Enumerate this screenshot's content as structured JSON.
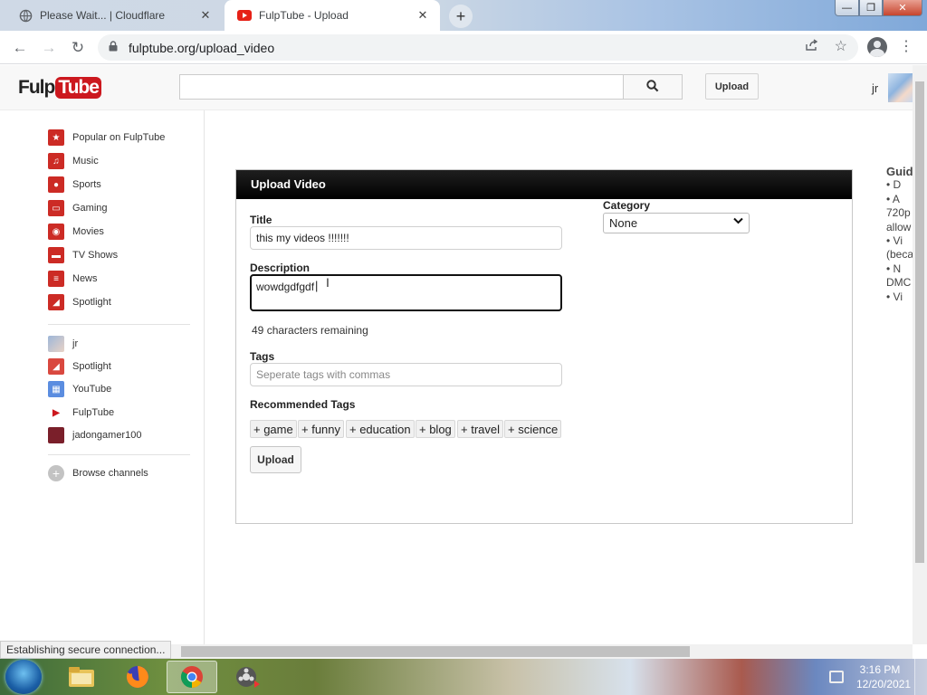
{
  "browser": {
    "tabs": [
      {
        "title": "Please Wait... | Cloudflare",
        "icon": "globe-icon"
      },
      {
        "title": "FulpTube - Upload",
        "icon": "fulptube-favicon-icon"
      }
    ],
    "url": "fulptube.org/upload_video"
  },
  "site": {
    "logo_left": "Fulp",
    "logo_right": "Tube",
    "upload_label": "Upload",
    "username": "jr"
  },
  "sidebar": {
    "top_items": [
      {
        "label": "Popular on FulpTube",
        "icon": "popular-icon"
      },
      {
        "label": "Music",
        "icon": "headphones-icon"
      },
      {
        "label": "Sports",
        "icon": "sports-icon"
      },
      {
        "label": "Gaming",
        "icon": "gamepad-icon"
      },
      {
        "label": "Movies",
        "icon": "film-icon"
      },
      {
        "label": "TV Shows",
        "icon": "tv-icon"
      },
      {
        "label": "News",
        "icon": "newspaper-icon"
      },
      {
        "label": "Spotlight",
        "icon": "spotlight-icon"
      }
    ],
    "sub_items": [
      {
        "label": "jr",
        "icon": "avatar-icon"
      },
      {
        "label": "Spotlight",
        "icon": "spotlight-icon"
      },
      {
        "label": "YouTube",
        "icon": "youtube-icon"
      },
      {
        "label": "FulpTube",
        "icon": "fulptube-icon"
      },
      {
        "label": "jadongamer100",
        "icon": "channel-avatar-icon"
      }
    ],
    "browse_label": "Browse channels"
  },
  "upload_form": {
    "header": "Upload Video",
    "title_label": "Title",
    "title_value": "this my videos !!!!!!!",
    "description_label": "Description",
    "description_value": "wowdgdfgdf",
    "chars_count": "49",
    "chars_suffix": "characters remaining",
    "tags_label": "Tags",
    "tags_placeholder": "Seperate tags with commas",
    "recommended_label": "Recommended Tags",
    "recommended_tags": [
      "+ game",
      "+ funny",
      "+ education",
      "+ blog",
      "+ travel",
      "+ science"
    ],
    "category_label": "Category",
    "category_value": "None",
    "submit_label": "Upload"
  },
  "guidelines": {
    "heading": "Guid",
    "lines": [
      "• D",
      "• A",
      "720p",
      "allow",
      "• Vi",
      "(beca",
      "• N",
      "DMC",
      "• Vi"
    ]
  },
  "status_bar": "Establishing secure connection...",
  "taskbar": {
    "time": "3:16 PM",
    "date": "12/20/2021"
  },
  "colors": {
    "brand_red": "#cc181e",
    "panel_header": "#000000"
  }
}
